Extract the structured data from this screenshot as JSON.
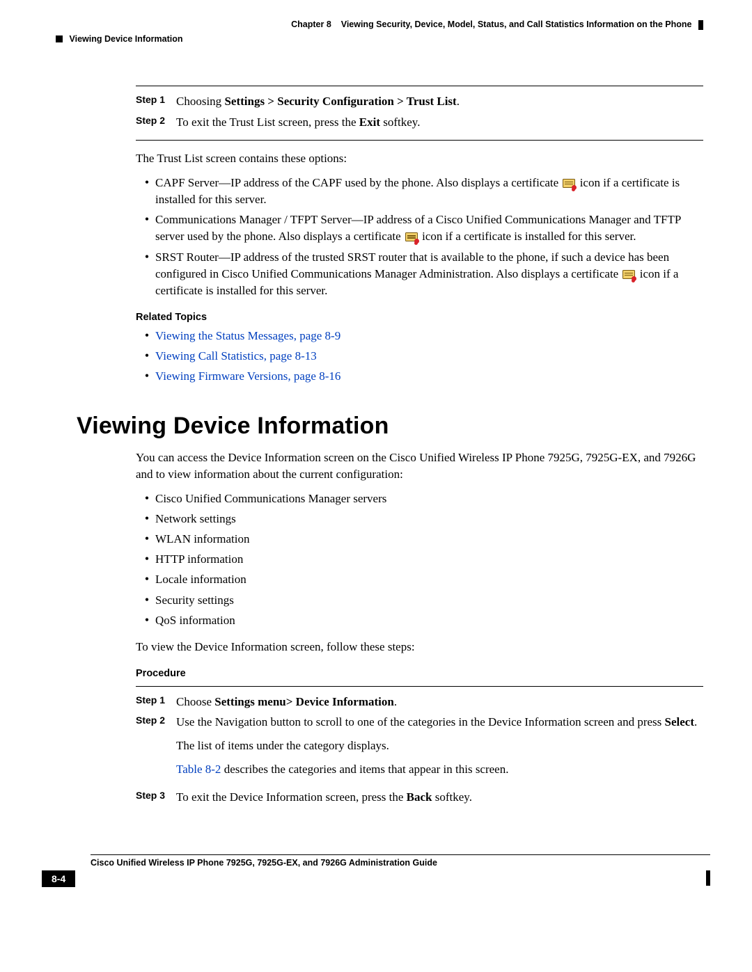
{
  "header": {
    "chapter_label": "Chapter 8",
    "chapter_title": "Viewing Security, Device, Model, Status, and Call Statistics Information on the Phone",
    "section": "Viewing Device Information"
  },
  "proc1": {
    "steps": [
      {
        "label": "Step 1",
        "pre": "Choosing ",
        "bold": "Settings > Security Configuration > Trust List",
        "post": "."
      },
      {
        "label": "Step 2",
        "pre": "To exit the Trust List screen, press the ",
        "bold": "Exit",
        "post": " softkey."
      }
    ]
  },
  "intro_para": "The Trust List screen contains these options:",
  "trust_list": [
    {
      "pre": "CAPF Server—IP address of the CAPF used by the phone. Also displays a certificate ",
      "post": " icon if a certificate is installed for this server."
    },
    {
      "pre": "Communications Manager / TFPT Server—IP address of a Cisco Unified Communications Manager and TFTP server used by the phone. Also displays a certificate ",
      "post": " icon if a certificate is installed for this server."
    },
    {
      "pre": "SRST Router—IP address of the trusted SRST router that is available to the phone, if such a device has been configured in Cisco Unified Communications Manager Administration. Also displays a certificate ",
      "post": " icon if a certificate is installed for this server."
    }
  ],
  "related_topics_title": "Related Topics",
  "related_links": [
    "Viewing the Status Messages, page 8-9",
    "Viewing Call Statistics, page 8-13",
    "Viewing Firmware Versions, page 8-16"
  ],
  "h1": "Viewing Device Information",
  "dev_intro": "You can access the Device Information screen on the Cisco Unified Wireless IP Phone 7925G, 7925G-EX, and 7926G and to view information about the current configuration:",
  "dev_bullets": [
    "Cisco Unified Communications Manager servers",
    "Network settings",
    "WLAN information",
    "HTTP information",
    "Locale information",
    "Security settings",
    "QoS information"
  ],
  "dev_para2": "To view the Device Information screen, follow these steps:",
  "procedure_title": "Procedure",
  "proc2": {
    "steps": [
      {
        "label": "Step 1",
        "pre": "Choose ",
        "bold": "Settings menu> Device Information",
        "post": "."
      },
      {
        "label": "Step 2",
        "line1_pre": "Use the Navigation button to scroll to one of the categories in the Device Information screen and press ",
        "line1_bold": "Select",
        "line1_post": ".",
        "extra1": "The list of items under the category displays.",
        "extra2_link": "Table 8-2",
        "extra2_rest": " describes the categories and items that appear in this screen."
      },
      {
        "label": "Step 3",
        "pre": "To exit the Device Information screen, press the ",
        "bold": "Back",
        "post": " softkey."
      }
    ]
  },
  "footer": {
    "guide": "Cisco Unified Wireless IP Phone 7925G, 7925G-EX, and 7926G Administration Guide",
    "page": "8-4"
  }
}
